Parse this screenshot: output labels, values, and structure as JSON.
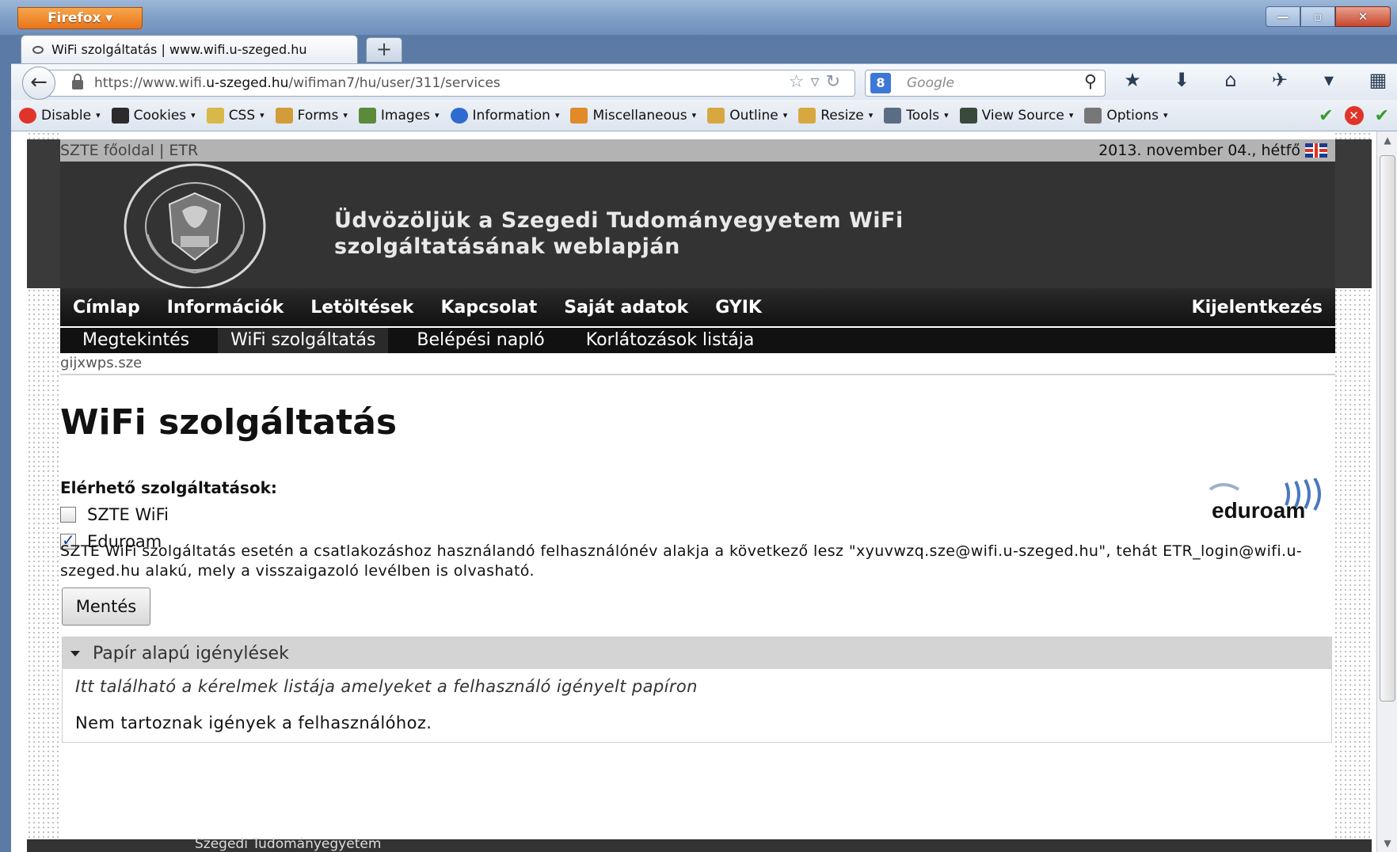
{
  "browser": {
    "menu_button": "Firefox",
    "tab_title": "WiFi szolgáltatás | www.wifi.u-szeged.hu",
    "new_tab": "+",
    "url_prefix": "https://www.wifi.",
    "url_domain": "u-szeged.hu",
    "url_path": "/wifiman7/hu/user/311/services",
    "search_placeholder": "Google",
    "search_engine_letter": "8"
  },
  "webdev_toolbar": {
    "items": [
      {
        "label": "Disable",
        "color": "#e0342a"
      },
      {
        "label": "Cookies",
        "color": "#2b2b2b"
      },
      {
        "label": "CSS",
        "color": "#d9b84a"
      },
      {
        "label": "Forms",
        "color": "#d29c3a"
      },
      {
        "label": "Images",
        "color": "#5a8a3a"
      },
      {
        "label": "Information",
        "color": "#2d6bd1"
      },
      {
        "label": "Miscellaneous",
        "color": "#e08a2a"
      },
      {
        "label": "Outline",
        "color": "#d8a840"
      },
      {
        "label": "Resize",
        "color": "#d8a840"
      },
      {
        "label": "Tools",
        "color": "#5a6d84"
      },
      {
        "label": "View Source",
        "color": "#3a4a3a"
      },
      {
        "label": "Options",
        "color": "#777777"
      }
    ]
  },
  "site": {
    "topbar_links": "SZTE főoldal | ETR",
    "date": "2013. november 04., hétfő",
    "header_title": "Üdvözöljük a Szegedi Tudományegyetem WiFi szolgáltatásának weblapján",
    "main_nav": [
      "Címlap",
      "Információk",
      "Letöltések",
      "Kapcsolat",
      "Saját adatok",
      "GYIK"
    ],
    "logout": "Kijelentkezés",
    "sub_nav": [
      "Megtekintés",
      "WiFi szolgáltatás",
      "Belépési napló",
      "Korlátozások listája"
    ],
    "breadcrumb": "gijxwps.sze",
    "page_title": "WiFi szolgáltatás",
    "services_label": "Elérhető szolgáltatások:",
    "services": [
      {
        "label": "SZTE WiFi",
        "checked": false
      },
      {
        "label": "Eduroam",
        "checked": true
      }
    ],
    "eduroam_logo": "eduroam",
    "info_text": "SZTE WiFi szolgáltatás esetén a csatlakozáshoz használandó felhasználónév alakja a következő lesz \"xyuvwzq.sze@wifi.u-szeged.hu\", tehát ETR_login@wifi.u-szeged.hu alakú, mely a visszaigazoló levélben is olvasható.",
    "save_button": "Mentés",
    "fieldset": {
      "legend": "Papír alapú igénylések",
      "description": "Itt található a kérelmek listája amelyeket a felhasználó igényelt papíron",
      "empty": "Nem tartoznak igények a felhasználóhoz."
    },
    "footer": "Szegedi Tudományegyetem"
  }
}
